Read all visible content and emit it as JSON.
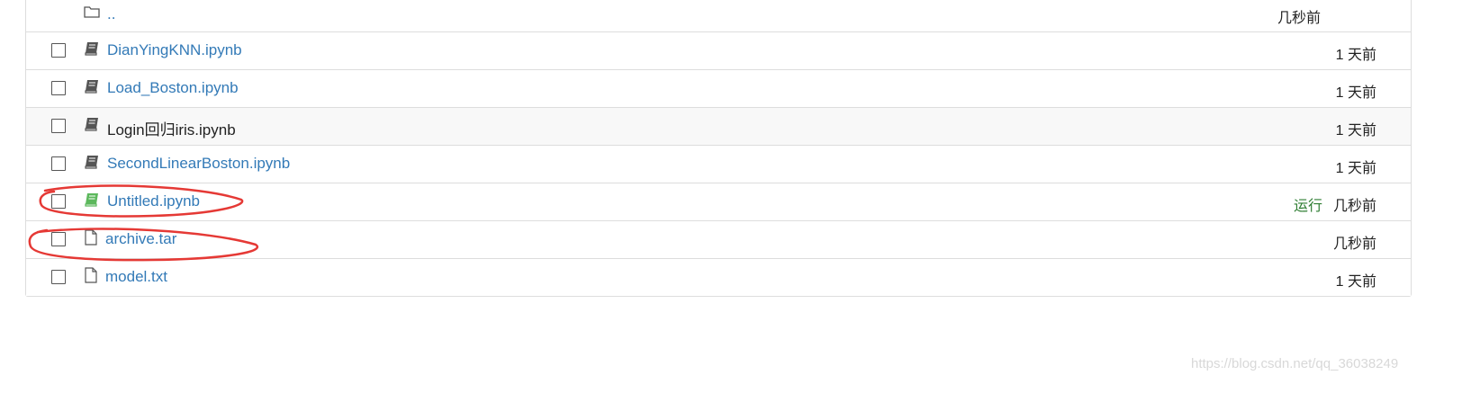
{
  "files": [
    {
      "name": "..",
      "type": "folder",
      "time": "几秒前",
      "checkbox": false
    },
    {
      "name": "DianYingKNN.ipynb",
      "type": "notebook",
      "time": "1 天前",
      "checkbox": true
    },
    {
      "name": "Load_Boston.ipynb",
      "type": "notebook",
      "time": "1 天前",
      "checkbox": true
    },
    {
      "name": "Login回归iris.ipynb",
      "type": "notebook",
      "time": "1 天前",
      "checkbox": true,
      "hovered": true
    },
    {
      "name": "SecondLinearBoston.ipynb",
      "type": "notebook",
      "time": "1 天前",
      "checkbox": true
    },
    {
      "name": "Untitled.ipynb",
      "type": "notebook-running",
      "status": "运行",
      "time": "几秒前",
      "checkbox": true
    },
    {
      "name": "archive.tar",
      "type": "file",
      "time": "几秒前",
      "checkbox": true
    },
    {
      "name": "model.txt",
      "type": "file",
      "time": "1 天前",
      "checkbox": true
    }
  ],
  "colors": {
    "link": "#337ab7",
    "running": "#2e7d32",
    "notebook_icon": "#555555",
    "running_icon": "#5cb85c",
    "annotation": "#e53935"
  },
  "icons": {
    "folder": "folder-icon",
    "notebook": "notebook-icon",
    "file": "file-icon"
  },
  "watermark": "https://blog.csdn.net/qq_36038249"
}
